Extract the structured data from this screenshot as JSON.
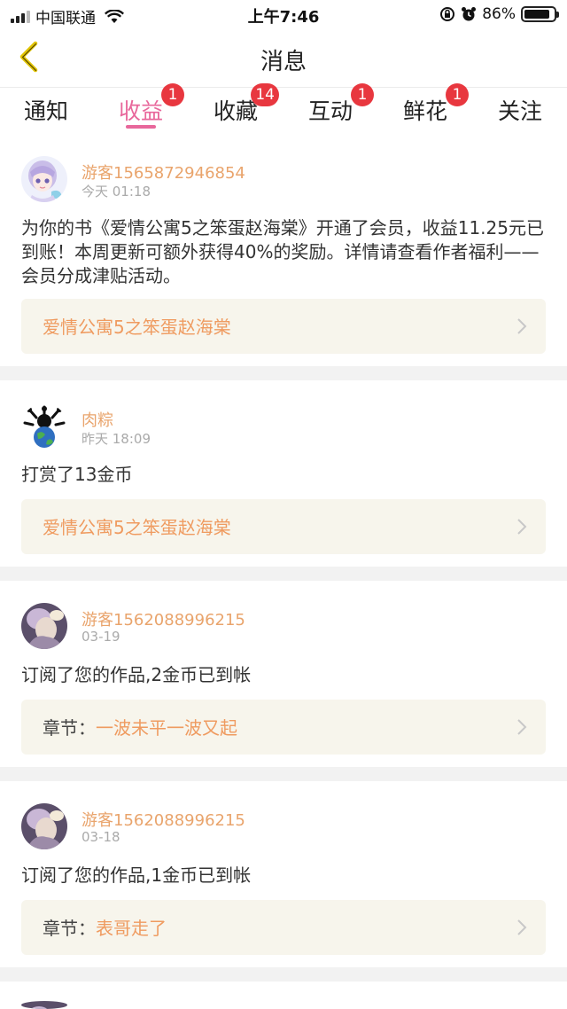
{
  "status_bar": {
    "carrier": "中国联通",
    "time": "上午7:46",
    "battery_percent": "86%",
    "battery_level": 0.86,
    "icons": [
      "signal-icon",
      "wifi-icon",
      "orientation-lock-icon",
      "alarm-icon",
      "battery-icon"
    ]
  },
  "header": {
    "title": "消息",
    "back_icon": "back-chevron-icon"
  },
  "tabs": [
    {
      "label": "通知",
      "badge": ""
    },
    {
      "label": "收益",
      "badge": "1",
      "active": true
    },
    {
      "label": "收藏",
      "badge": "14"
    },
    {
      "label": "互动",
      "badge": "1"
    },
    {
      "label": "鲜花",
      "badge": "1"
    },
    {
      "label": "关注",
      "badge": ""
    }
  ],
  "messages": [
    {
      "user": "游客1565872946854",
      "time": "今天 01:18",
      "body": "为你的书《爱情公寓5之笨蛋赵海棠》开通了会员，收益11.25元已到账！本周更新可额外获得40%的奖励。详情请查看作者福利——会员分成津贴活动。",
      "link_prefix": "",
      "link_text": "爱情公寓5之笨蛋赵海棠"
    },
    {
      "user": "肉粽",
      "time": "昨天 18:09",
      "body": "打赏了13金币",
      "link_prefix": "",
      "link_text": "爱情公寓5之笨蛋赵海棠"
    },
    {
      "user": "游客1562088996215",
      "time": "03-19",
      "body": "订阅了您的作品,2金币已到帐",
      "link_prefix": "章节：",
      "link_text": "一波未平一波又起"
    },
    {
      "user": "游客1562088996215",
      "time": "03-18",
      "body": "订阅了您的作品,1金币已到帐",
      "link_prefix": "章节：",
      "link_text": "表哥走了"
    }
  ],
  "colors": {
    "accent_pink": "#e8679b",
    "badge_red": "#e8373f",
    "username_orange": "#e9a46c",
    "link_orange": "#ef9b60",
    "link_box_bg": "#f7f5ec"
  }
}
